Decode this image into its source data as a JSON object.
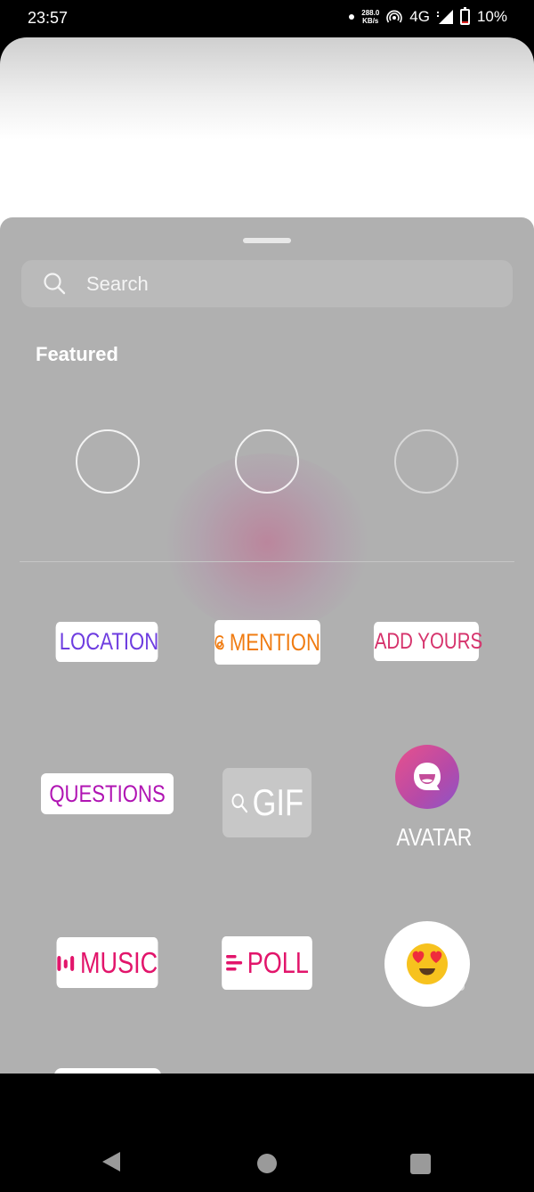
{
  "status_bar": {
    "time": "23:57",
    "net_speed_value": "288.0",
    "net_speed_unit": "KB/s",
    "network_type": "4G",
    "battery_percent": "10%",
    "battery_level": 0.1,
    "icons": [
      "notification-dot-icon",
      "hotspot-icon",
      "signal-icon",
      "battery-icon"
    ]
  },
  "sticker_tray": {
    "search": {
      "placeholder": "Search",
      "value": ""
    },
    "section_title": "Featured",
    "featured_loading_count": 3,
    "stickers": [
      {
        "id": "location",
        "label": "LOCATION",
        "icon": "location-pin-icon",
        "color": "#6e3de0"
      },
      {
        "id": "mention",
        "label": "MENTION",
        "icon": "threads-at-icon",
        "color": "#f07c12"
      },
      {
        "id": "add-yours",
        "label": "ADD YOURS",
        "icon": "camera-icon",
        "color": "#d6336c"
      },
      {
        "id": "questions",
        "label": "QUESTIONS",
        "color": "#b014b3"
      },
      {
        "id": "gif",
        "label": "GIF",
        "icon": "search-icon",
        "color": "#ffffff"
      },
      {
        "id": "avatar",
        "label": "AVATAR",
        "icon": "avatar-icon"
      },
      {
        "id": "music",
        "label": "MUSIC",
        "icon": "music-bars-icon",
        "color": "#e2156b"
      },
      {
        "id": "poll",
        "label": "POLL",
        "icon": "poll-lines-icon",
        "color": "#e2156b"
      },
      {
        "id": "emoji-slider",
        "label": "😍",
        "icon": "heart-eyes-emoji-icon"
      }
    ]
  },
  "nav_bar": {
    "buttons": [
      "back",
      "home",
      "recents"
    ]
  }
}
